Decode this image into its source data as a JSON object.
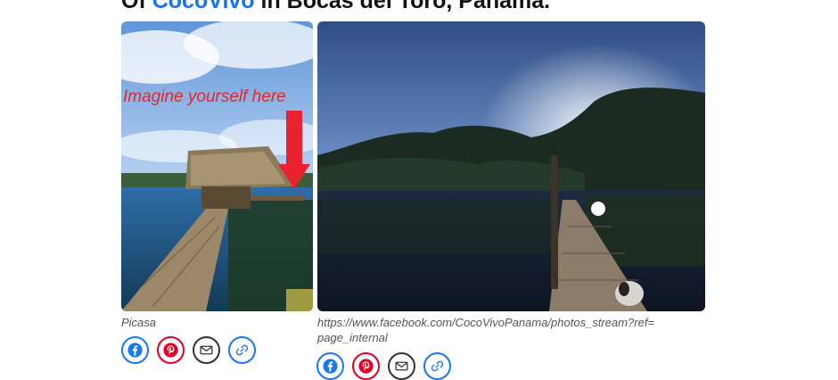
{
  "heading": {
    "prefix": "Of ",
    "link_text": "CocoVivo",
    "suffix": " in Bocas del Toro, Panama."
  },
  "photos": [
    {
      "overlay_text": "Imagine yourself here",
      "caption": "Picasa",
      "share_icons": [
        "facebook-icon",
        "pinterest-icon",
        "email-icon",
        "link-icon"
      ]
    },
    {
      "caption": "https://www.facebook.com/CocoVivoPanama/photos_stream?ref=page_internal",
      "share_icons": [
        "facebook-icon",
        "pinterest-icon",
        "email-icon",
        "link-icon"
      ]
    }
  ],
  "colors": {
    "link": "#1a73e8",
    "facebook": "#1877f2",
    "pinterest": "#e60023",
    "email": "#333333",
    "overlay_text": "#e8222e"
  }
}
